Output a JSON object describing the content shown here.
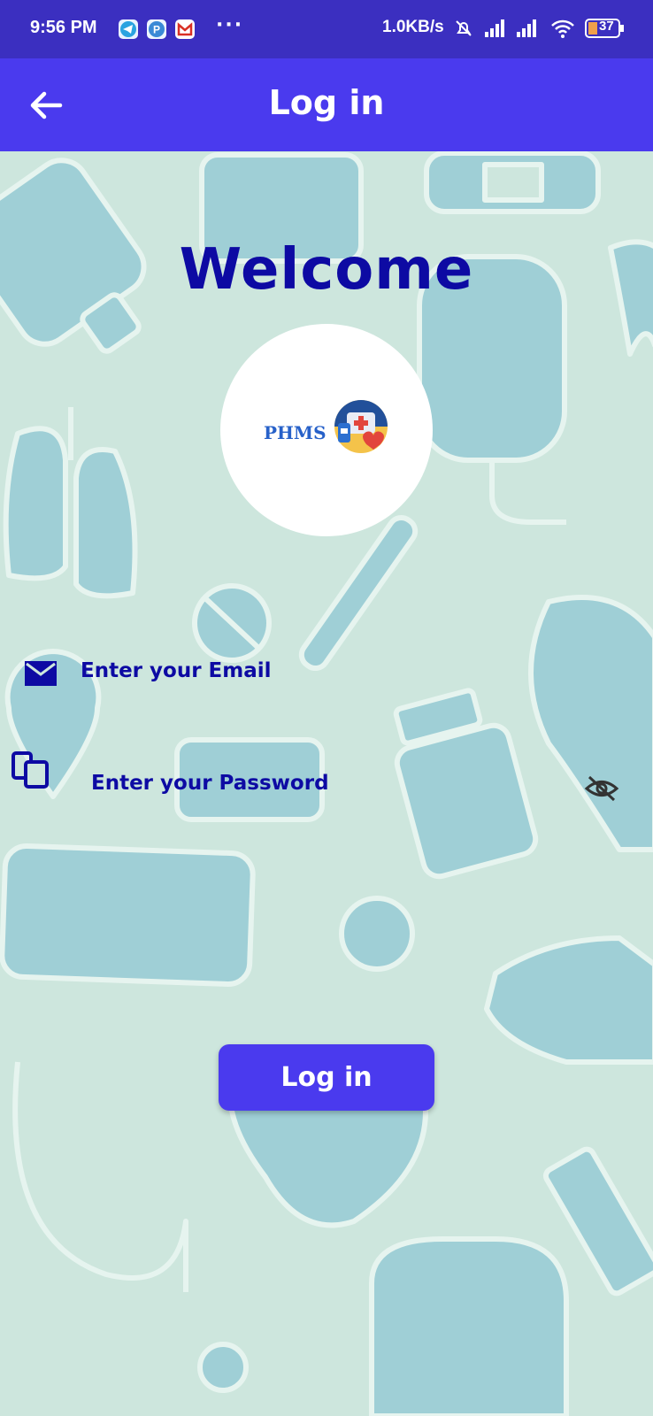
{
  "status_bar": {
    "time": "9:56 PM",
    "more": "···",
    "network_speed": "1.0KB/s",
    "battery": "37",
    "icons": [
      "telegram-icon",
      "p-app-icon",
      "gmail-icon",
      "mute-icon",
      "signal-icon",
      "signal-icon",
      "wifi-icon",
      "battery-icon"
    ]
  },
  "app_bar": {
    "title": "Log in",
    "back_icon": "arrow-left-icon"
  },
  "main": {
    "heading": "Welcome",
    "logo_text": "PHMS",
    "email": {
      "placeholder": "Enter your Email",
      "icon": "mail-icon"
    },
    "password": {
      "placeholder": "Enter your Password",
      "icon": "clipboard-icon",
      "toggle_icon": "eye-off-icon"
    },
    "login_button": "Log in"
  },
  "colors": {
    "status_bar": "#3b2fc0",
    "app_bar": "#4a3aee",
    "background": "#cde6dd",
    "heading": "#0d0aa3",
    "button": "#4a3aee"
  }
}
